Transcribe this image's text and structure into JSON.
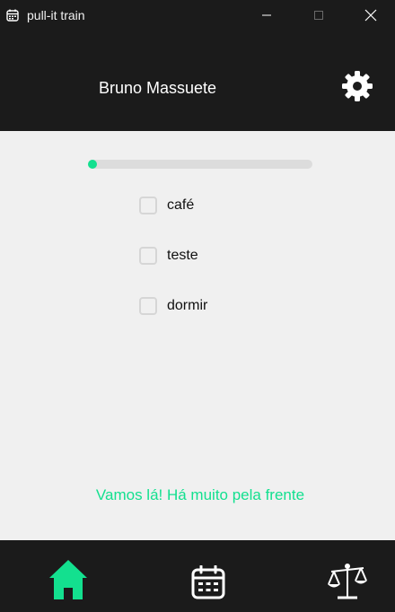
{
  "window": {
    "title": "pull-it train"
  },
  "header": {
    "user_name": "Bruno Massuete"
  },
  "progress": {
    "value": 0.0
  },
  "tasks": [
    {
      "label": "café",
      "checked": false
    },
    {
      "label": "teste",
      "checked": false
    },
    {
      "label": "dormir",
      "checked": false
    }
  ],
  "motivation": "Vamos lá! Há muito pela frente",
  "colors": {
    "accent": "#13e08f",
    "bar_bg": "#1b1b1b",
    "content_bg": "#f0f0f0"
  },
  "nav": {
    "items": [
      {
        "icon": "home-icon",
        "active": true
      },
      {
        "icon": "calendar-icon",
        "active": false
      },
      {
        "icon": "scale-icon",
        "active": false
      }
    ]
  }
}
